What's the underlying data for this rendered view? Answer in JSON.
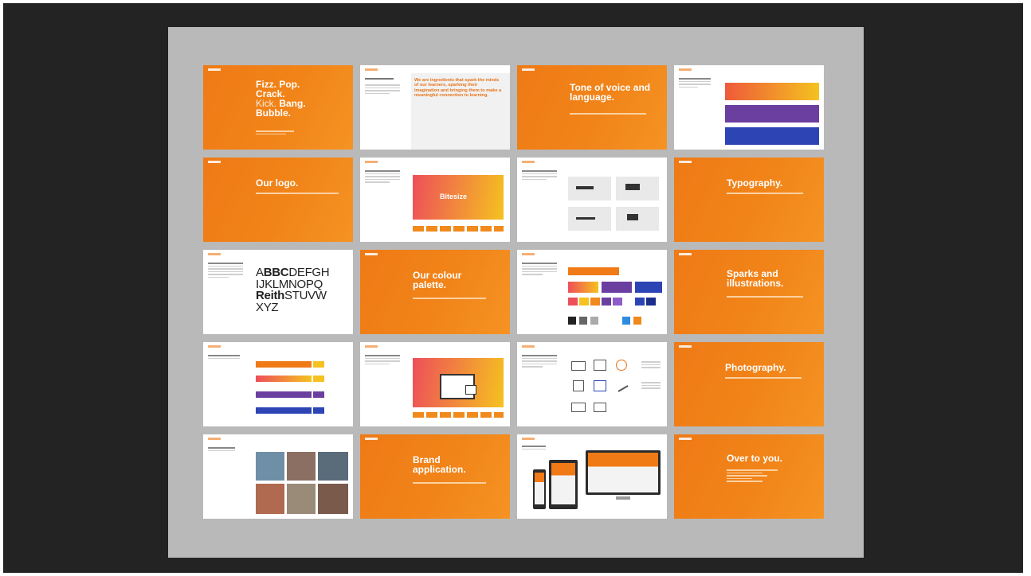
{
  "slides": {
    "s1": {
      "line1": "Fizz. Pop.",
      "line2": "Crack.",
      "line3_a": "Kick. ",
      "line3_b": "Bang.",
      "line4": "Bubble."
    },
    "s2": {
      "quote": "We are ingredients that spark the minds of our learners, sparking their imagination and bringing them to make a meaningful connection to learning."
    },
    "s3": {
      "title": "Tone of voice and language."
    },
    "s5": {
      "title": "Our logo."
    },
    "s6": {
      "word": "Bitesize"
    },
    "s8": {
      "title": "Typography."
    },
    "s9": {
      "row1_a": "A",
      "row1_b": "BBC",
      "row1_c": "DEFGH",
      "row2": "IJKLMNOPQ",
      "row3_a": "Reith",
      "row3_b": "STUVW",
      "row4": "XYZ"
    },
    "s10": {
      "title": "Our colour palette."
    },
    "s12": {
      "title": "Sparks and illustrations."
    },
    "s16": {
      "title": "Photography."
    },
    "s18": {
      "title": "Brand application."
    },
    "s20": {
      "title": "Over to you."
    }
  },
  "colors": {
    "orange": "#ef7a16",
    "purple": "#6b3fa0",
    "blue": "#2d44b5",
    "yellow": "#f5c21f"
  }
}
